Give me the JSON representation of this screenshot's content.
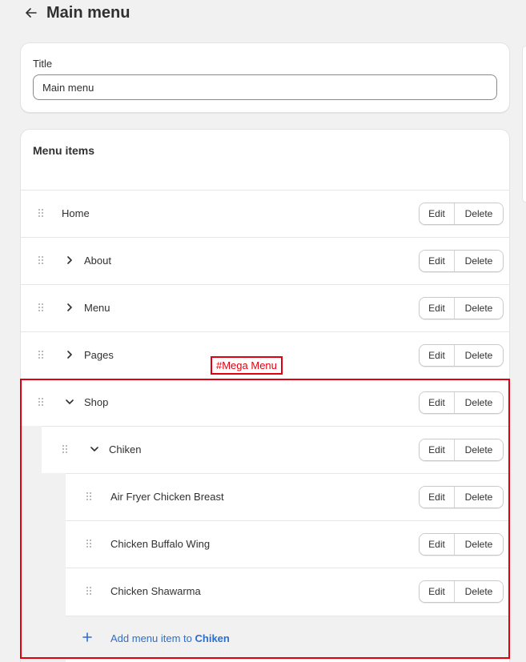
{
  "header": {
    "back_icon": "arrow-left-icon",
    "title": "Main menu"
  },
  "title_section": {
    "label": "Title",
    "value": "Main menu"
  },
  "menu": {
    "heading": "Menu items",
    "edit_label": "Edit",
    "delete_label": "Delete",
    "items": [
      {
        "label": "Home",
        "level": 0,
        "expander": "none"
      },
      {
        "label": "About",
        "level": 0,
        "expander": "collapsed"
      },
      {
        "label": "Menu",
        "level": 0,
        "expander": "collapsed"
      },
      {
        "label": "Pages",
        "level": 0,
        "expander": "collapsed"
      },
      {
        "label": "Shop",
        "level": 0,
        "expander": "expanded"
      },
      {
        "label": "Chiken",
        "level": 1,
        "expander": "expanded"
      },
      {
        "label": "Air Fryer Chicken Breast",
        "level": 2,
        "expander": "none"
      },
      {
        "label": "Chicken Buffalo Wing",
        "level": 2,
        "expander": "none"
      },
      {
        "label": "Chicken Shawarma",
        "level": 2,
        "expander": "none"
      }
    ],
    "add_item": {
      "prefix": "Add menu item to ",
      "target": "Chiken",
      "icon": "plus-icon"
    }
  },
  "annotation": {
    "label": "#Mega Menu",
    "color": "#e0000f"
  },
  "colors": {
    "accent_link": "#2c6ecb",
    "background": "#f1f1f1"
  }
}
